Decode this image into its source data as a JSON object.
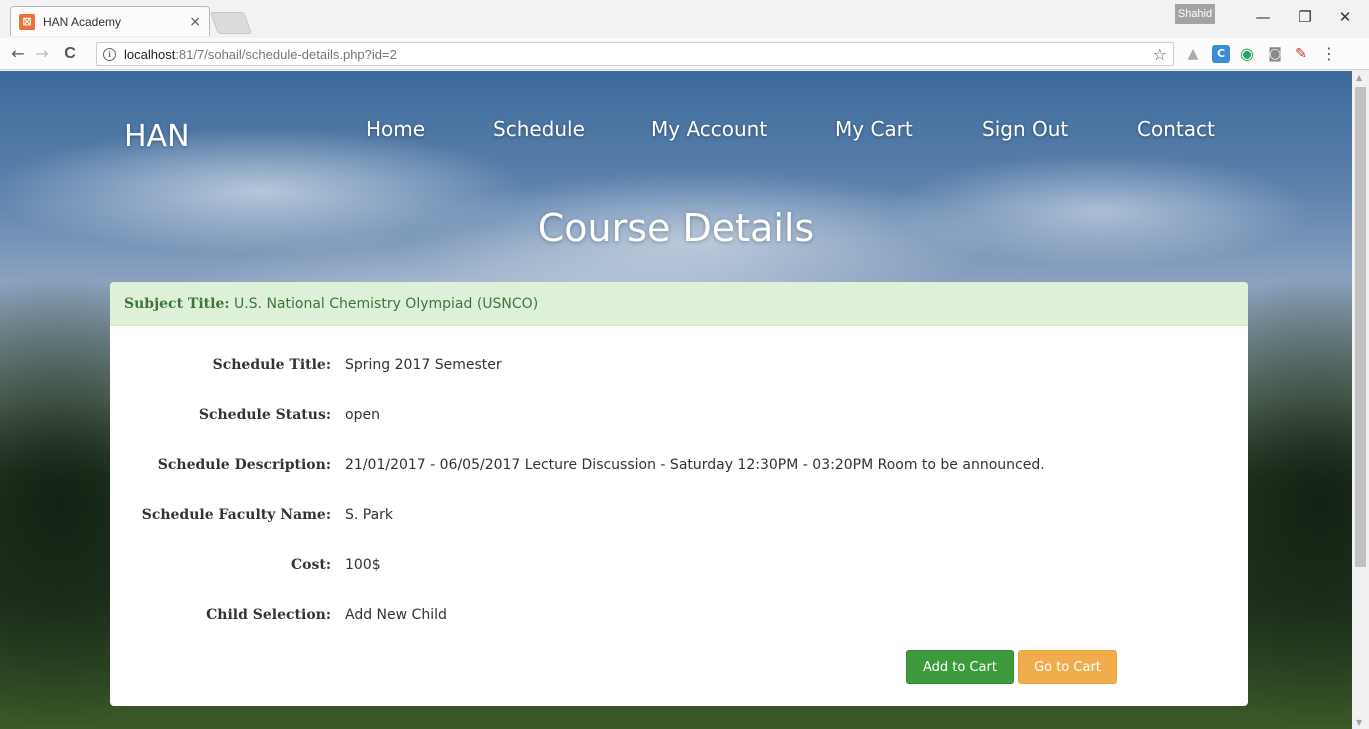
{
  "browser": {
    "tab_title": "HAN Academy",
    "tab_close": "×",
    "profile_name": "Shahid",
    "url_host": "localhost",
    "url_path": ":81/7/sohail/schedule-details.php?id=2",
    "window_buttons": {
      "minimize": "—",
      "restore": "❐",
      "close": "✕"
    },
    "nav": {
      "back": "←",
      "forward": "→",
      "reload": "C"
    },
    "star": "☆"
  },
  "site": {
    "brand": "HAN",
    "nav": [
      "Home",
      "Schedule",
      "My Account",
      "My Cart",
      "Sign Out",
      "Contact"
    ],
    "page_title": "Course Details"
  },
  "panel": {
    "heading_label": "Subject Title:",
    "heading_value": "U.S. National Chemistry Olympiad (USNCO)",
    "rows": [
      {
        "label": "Schedule Title:",
        "value": "Spring 2017 Semester"
      },
      {
        "label": "Schedule Status:",
        "value": "open"
      },
      {
        "label": "Schedule Description:",
        "value": "21/01/2017 - 06/05/2017 Lecture Discussion - Saturday 12:30PM - 03:20PM Room to be announced."
      },
      {
        "label": "Schedule Faculty Name:",
        "value": "S. Park"
      },
      {
        "label": "Cost:",
        "value": "100$"
      },
      {
        "label": "Child Selection:",
        "value": "Add New Child"
      }
    ],
    "add_to_cart": "Add to Cart",
    "go_to_cart": "Go to Cart"
  }
}
